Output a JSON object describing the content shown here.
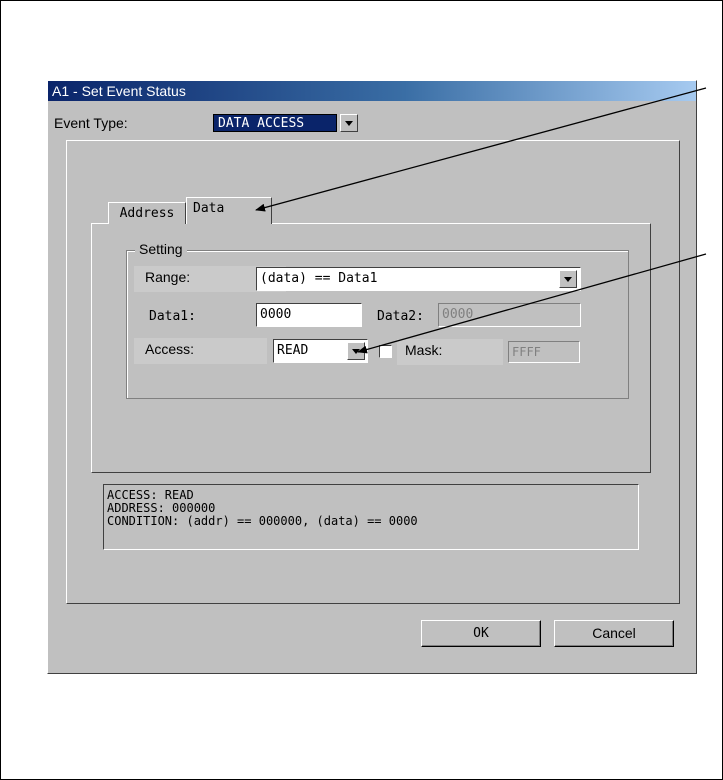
{
  "dialog": {
    "title": "A1 - Set Event Status",
    "event_type_label": "Event Type:",
    "event_type_value": "DATA ACCESS",
    "tabs": [
      {
        "label": "Address"
      },
      {
        "label": "Data"
      }
    ],
    "setting": {
      "group_label": "Setting",
      "range_label": "Range:",
      "range_value": "(data) == Data1",
      "data1_label": "Data1:",
      "data1_value": "0000",
      "data2_label": "Data2:",
      "data2_value": "0000",
      "access_label": "Access:",
      "access_value": "READ",
      "mask_label": "Mask:",
      "mask_value": "FFFF"
    },
    "status_lines": [
      "ACCESS: READ",
      "ADDRESS: 000000",
      "CONDITION: (addr) == 000000, (data) == 0000"
    ],
    "ok_label": "OK",
    "cancel_label": "Cancel"
  },
  "colors": {
    "dialog_bg": "#c0c0c0",
    "title_start": "#0a246a",
    "title_end": "#a6caf0",
    "selection": "#0a246a"
  }
}
